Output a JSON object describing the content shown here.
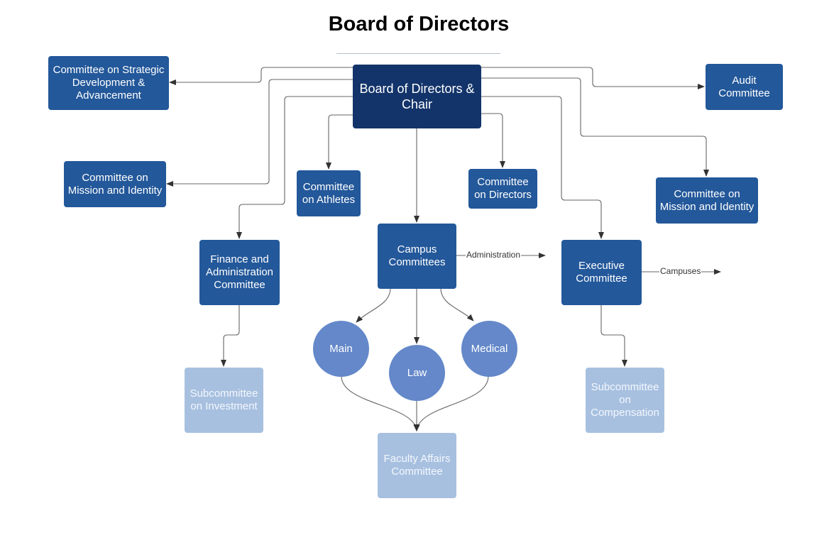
{
  "title": "Board of Directors",
  "colors": {
    "root": "#13346a",
    "committee": "#23589a",
    "campus": "#6488c9",
    "subcommittee": "#a7c0e0",
    "connector": "#555555"
  },
  "nodes": {
    "board": "Board of Directors & Chair",
    "strategic": "Committee on Strategic Development & Advancement",
    "audit": "Audit Committee",
    "mission_left": "Committee on Mission and Identity",
    "athletes": "Committee on Athletes",
    "directors": "Committee on Directors",
    "mission_right": "Committee on Mission and Identity",
    "finance": "Finance and Administration Committee",
    "campus": "Campus Committees",
    "executive": "Executive Committee",
    "main": "Main",
    "law": "Law",
    "medical": "Medical",
    "investment": "Subcommittee on Investment",
    "compensation": "Subcommittee on Compensation",
    "faculty": "Faculty Affairs Committee"
  },
  "edge_labels": {
    "administration": "Administration",
    "campuses": "Campuses"
  },
  "edges": [
    [
      "board",
      "strategic"
    ],
    [
      "board",
      "audit"
    ],
    [
      "board",
      "mission_left"
    ],
    [
      "board",
      "athletes"
    ],
    [
      "board",
      "directors"
    ],
    [
      "board",
      "mission_right"
    ],
    [
      "board",
      "finance"
    ],
    [
      "board",
      "campus"
    ],
    [
      "board",
      "executive"
    ],
    [
      "campus",
      "main"
    ],
    [
      "campus",
      "law"
    ],
    [
      "campus",
      "medical"
    ],
    [
      "main",
      "faculty"
    ],
    [
      "law",
      "faculty"
    ],
    [
      "medical",
      "faculty"
    ],
    [
      "finance",
      "investment"
    ],
    [
      "executive",
      "compensation"
    ]
  ]
}
